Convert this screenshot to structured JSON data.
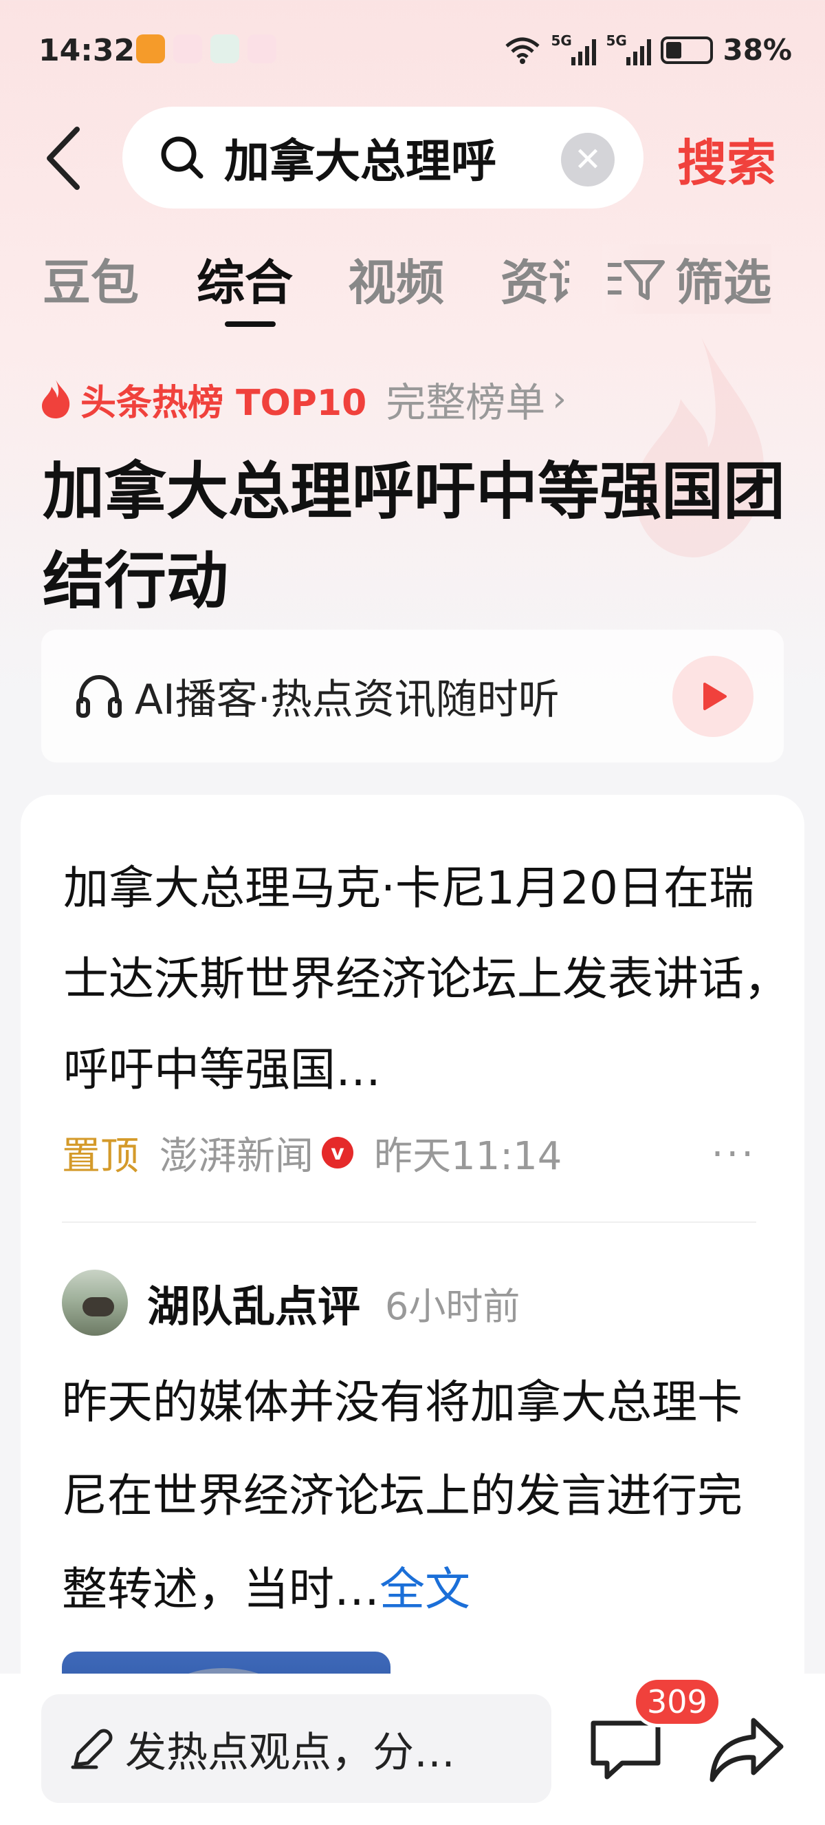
{
  "status_bar": {
    "time": "14:32",
    "net1": "5G",
    "net2": "5G",
    "battery": "38%"
  },
  "search": {
    "query": "加拿大总理呼",
    "clear_glyph": "✕",
    "button": "搜索"
  },
  "tabs": {
    "items": [
      "豆包",
      "综合",
      "视频",
      "资讯"
    ],
    "active": "综合",
    "filter": "筛选"
  },
  "hot_rank": {
    "label": "头条热榜 TOP10",
    "more": "完整榜单",
    "chevron": "›"
  },
  "headline": "加拿大总理呼吁中等强国团结行动",
  "ai_podcast": {
    "text": "AI播客·热点资讯随时听"
  },
  "article": {
    "text": "加拿大总理马克·卡尼1月20日在瑞士达沃斯世界经济论坛上发表讲话，呼吁中等强国…",
    "pinned": "置顶",
    "source": "澎湃新闻",
    "verified": "v",
    "time": "昨天11:14",
    "more": "···"
  },
  "post": {
    "author": "湖队乱点评",
    "time": "6小时前",
    "text": "昨天的媒体并没有将加拿大总理卡尼在世界经济论坛上的发言进行完整转述，当时…",
    "full_link": "全文"
  },
  "bottom_bar": {
    "comment_placeholder": "发热点观点，分…",
    "comment_count": "309"
  },
  "colors": {
    "accent": "#f0413c",
    "pinned": "#d49a2a",
    "link": "#1b6fd8"
  },
  "icons": [
    "back-arrow-icon",
    "search-icon",
    "clear-icon",
    "filter-icon",
    "flame-icon",
    "headphone-icon",
    "play-icon",
    "verified-icon",
    "more-icon",
    "pen-icon",
    "comment-icon",
    "share-icon"
  ]
}
